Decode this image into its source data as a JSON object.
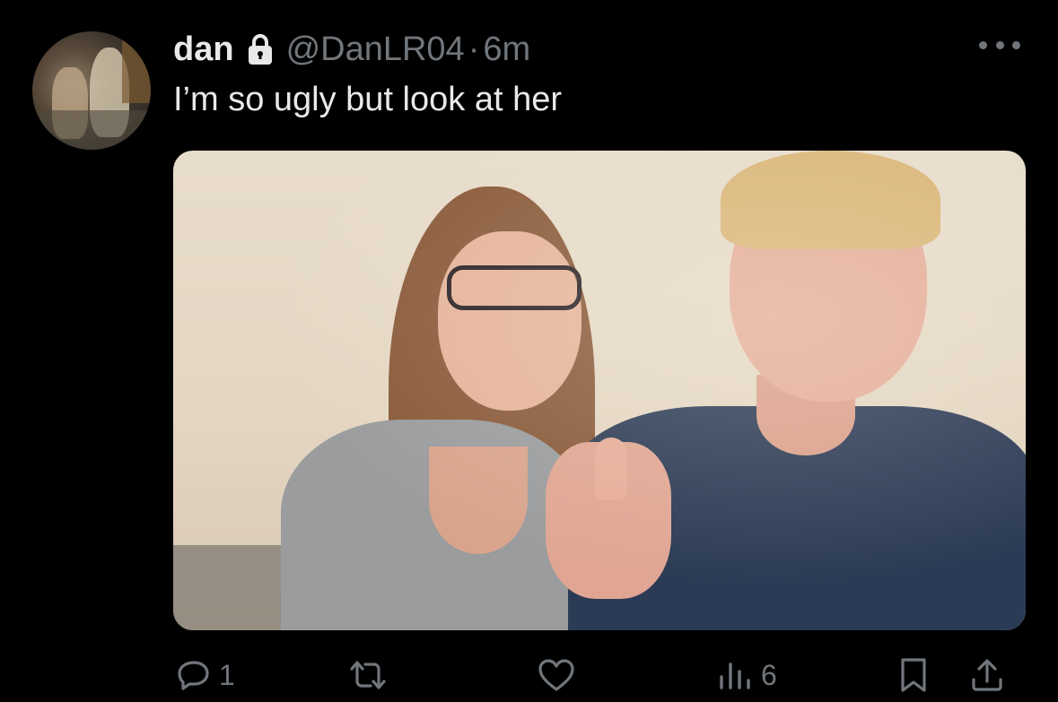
{
  "tweet": {
    "display_name": "dan",
    "handle": "@DanLR04",
    "separator": "·",
    "time": "6m",
    "text": "I’m so ugly but look at her",
    "protected_icon": "lock-icon",
    "more_icon": "more-options-icon"
  },
  "actions": {
    "reply": {
      "icon": "reply-icon",
      "count": "1"
    },
    "retweet": {
      "icon": "retweet-icon",
      "count": ""
    },
    "like": {
      "icon": "heart-icon",
      "count": ""
    },
    "views": {
      "icon": "views-icon",
      "count": "6"
    },
    "bookmark": {
      "icon": "bookmark-icon"
    },
    "share": {
      "icon": "share-icon"
    }
  },
  "colors": {
    "background": "#000000",
    "primary_text": "#e7e9ea",
    "secondary_text": "#71767b"
  }
}
